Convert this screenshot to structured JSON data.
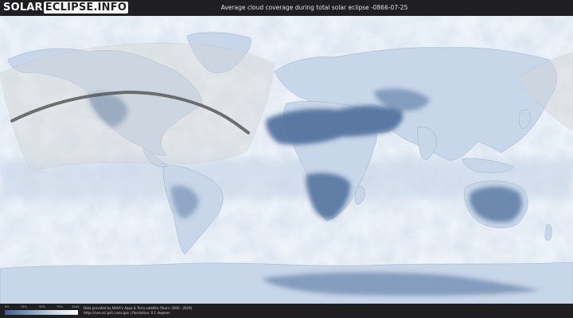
{
  "header": {
    "logo_part1": "SOLAR",
    "logo_part2": "ECLIPSE.INFO",
    "title": "Average cloud coverage during total solar eclipse -0866-07-25"
  },
  "legend": {
    "ticks": [
      "0%",
      "25%",
      "50%",
      "75%",
      "100%"
    ],
    "colors": [
      "#3e5f8c",
      "#7d9bbf",
      "#c9d7e7",
      "#ffffff"
    ]
  },
  "footer": {
    "credit_line1": "Data provided by NASA's Aqua & Terra satellite (Years: 2000 - 2019)",
    "credit_line2": "https://neo.sci.gsfc.nasa.gov | Resolution: 0.1 degrees"
  },
  "colors": {
    "cloudy": "#eef3f9",
    "clear": "#4d6d98",
    "ocean_base": "#f4f7fb",
    "eclipse_path": "#555555"
  }
}
